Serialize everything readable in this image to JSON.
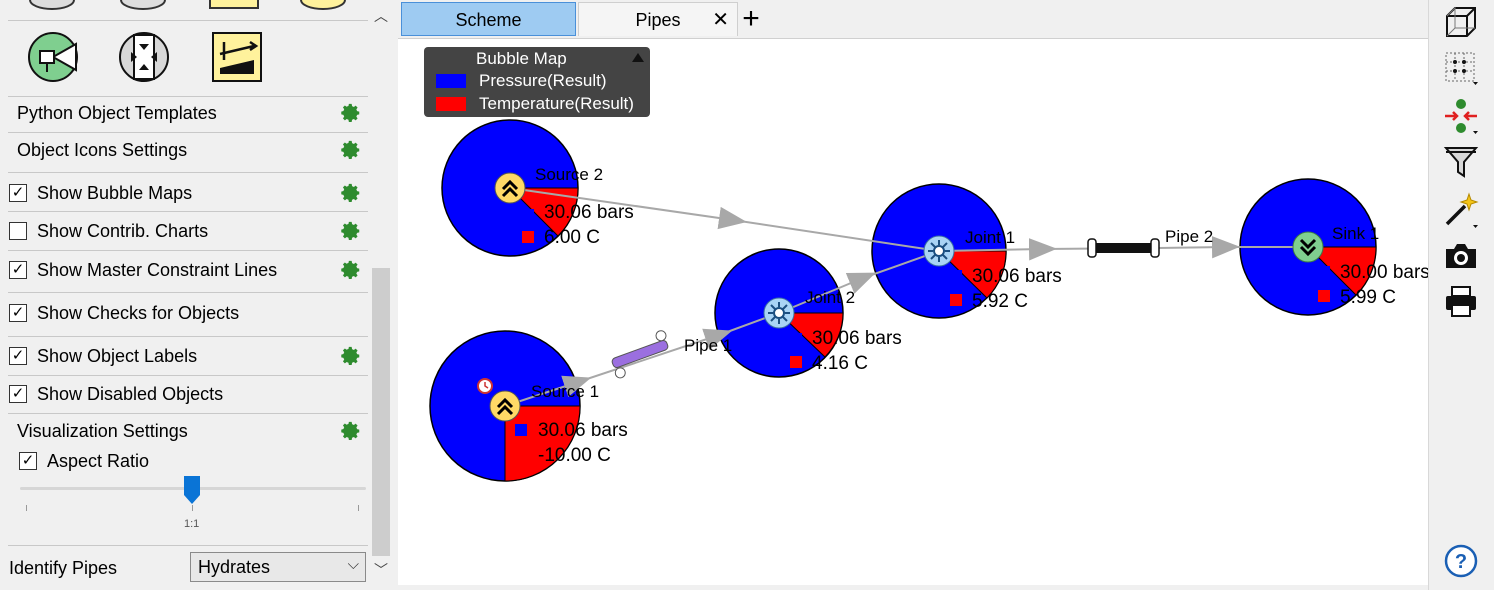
{
  "left_panel": {
    "sections": {
      "python_templates": "Python Object Templates",
      "object_icons": "Object Icons Settings",
      "show_bubble_maps": "Show Bubble Maps",
      "show_contrib_charts": "Show Contrib. Charts",
      "show_master_constraint": "Show Master Constraint Lines",
      "show_checks": "Show Checks for Objects",
      "show_object_labels": "Show Object Labels",
      "show_disabled": "Show Disabled Objects",
      "visualization": "Visualization Settings",
      "aspect_ratio": "Aspect Ratio"
    },
    "checked": {
      "show_bubble_maps": true,
      "show_contrib_charts": false,
      "show_master_constraint": true,
      "show_checks": true,
      "show_object_labels": true,
      "show_disabled": true,
      "aspect_ratio": true
    },
    "slider": {
      "ratio_label": "1:1"
    },
    "identify_pipes": {
      "label": "Identify Pipes",
      "value": "Hydrates"
    },
    "check_mark": "☑"
  },
  "tabs": [
    {
      "label": "Scheme",
      "active": true
    },
    {
      "label": "Pipes",
      "active": false
    }
  ],
  "legend": {
    "title": "Bubble Map",
    "items": [
      {
        "label": "Pressure(Result)",
        "color": "#0000ff"
      },
      {
        "label": "Temperature(Result)",
        "color": "#ff0000"
      }
    ]
  },
  "nodes": {
    "source2": {
      "label": "Source 2",
      "pressure": "30.06 bars",
      "temperature": "6.00 C"
    },
    "source1": {
      "label": "Source 1",
      "pressure": "30.06 bars",
      "temperature": "-10.00 C"
    },
    "joint2": {
      "label": "Joint 2",
      "pressure": "30.06 bars",
      "temperature": "4.16 C"
    },
    "joint1": {
      "label": "Joint 1",
      "pressure": "30.06 bars",
      "temperature": "5.92 C"
    },
    "sink1": {
      "label": "Sink 1",
      "pressure": "30.00 bars",
      "temperature": "5.99 C"
    }
  },
  "pipes": {
    "pipe1": {
      "label": "Pipe 1"
    },
    "pipe2": {
      "label": "Pipe 2"
    }
  },
  "colors": {
    "pressure": "#0000ff",
    "temperature": "#ff0000",
    "gear": "#2e8b2e",
    "tab_active": "#9ecbf2"
  },
  "right_toolbar": [
    "3d-view-icon",
    "grid-icon",
    "connect-icon",
    "filter-icon",
    "magic-wand-icon",
    "camera-icon",
    "print-icon",
    "help-icon"
  ]
}
